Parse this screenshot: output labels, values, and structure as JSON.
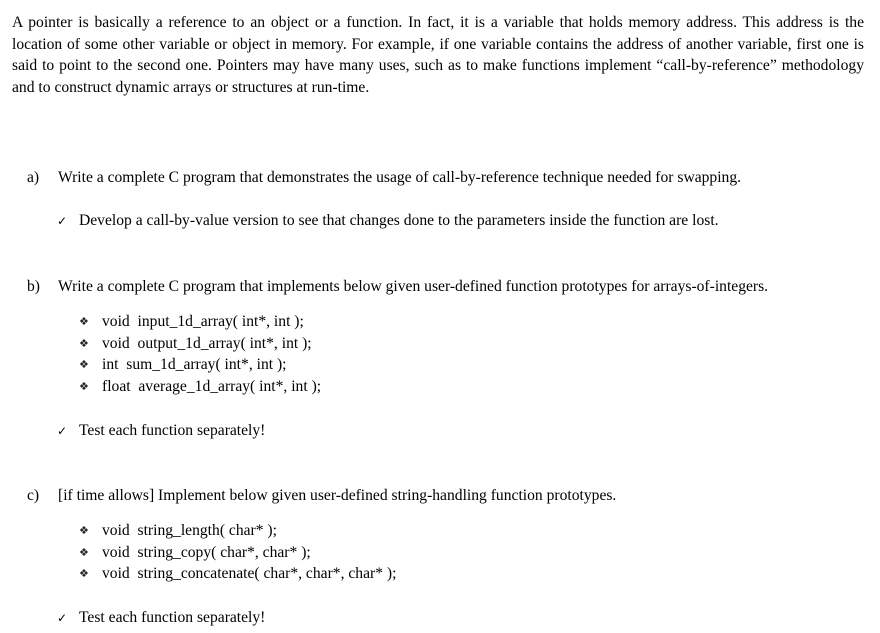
{
  "intro": {
    "text": "A pointer is basically a reference to an object or a function. In fact, it is a variable that holds memory address. This address is the location of some other variable or object in memory. For example, if one variable contains the address of another variable, first one is said to point to the second one. Pointers may have many uses, such as to make functions implement “call-by-reference” methodology and to construct dynamic arrays or structures at run-time."
  },
  "icons": {
    "check": "✓",
    "bullet": "❖"
  },
  "questions": [
    {
      "marker": "a)",
      "text": "Write a complete C program that demonstrates the usage of call-by-reference technique needed for swapping.",
      "bullets": [],
      "notes": [
        "Develop a call-by-value version to see that changes done to the parameters inside the function are lost."
      ]
    },
    {
      "marker": "b)",
      "text": "Write a complete C program that implements below given user-defined function prototypes for arrays-of-integers.",
      "bullets": [
        "void  input_1d_array( int*, int );",
        "void  output_1d_array( int*, int );",
        "int  sum_1d_array( int*, int );",
        "float  average_1d_array( int*, int );"
      ],
      "notes": [
        "Test each function separately!"
      ]
    },
    {
      "marker": "c)",
      "text": "[if time allows] Implement below given user-defined string-handling function prototypes.",
      "bullets": [
        "void  string_length( char* );",
        "void  string_copy( char*, char* );",
        "void  string_concatenate( char*, char*, char* );"
      ],
      "notes": [
        "Test each function separately!"
      ]
    }
  ]
}
